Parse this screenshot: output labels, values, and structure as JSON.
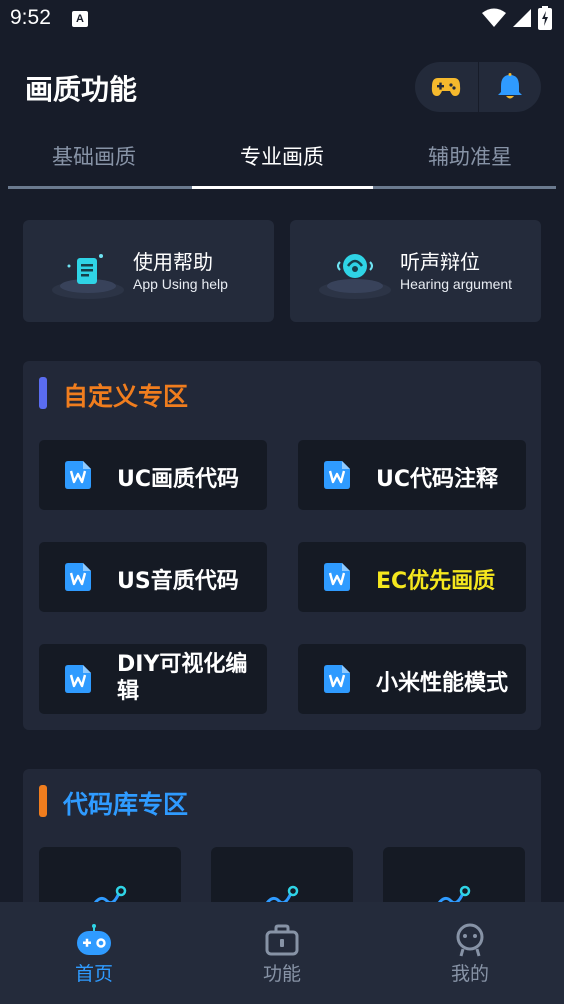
{
  "status": {
    "time": "9:52",
    "a_badge": "A"
  },
  "header": {
    "title": "画质功能",
    "actions": [
      {
        "icon": "gamepad-icon",
        "color": "#f5b92d"
      },
      {
        "icon": "bell-icon",
        "color": "#2f9bff"
      }
    ]
  },
  "tabs": [
    {
      "label": "基础画质",
      "active": false
    },
    {
      "label": "专业画质",
      "active": true
    },
    {
      "label": "辅助准星",
      "active": false
    }
  ],
  "help_cards": [
    {
      "title": "使用帮助",
      "subtitle": "App Using help",
      "icon": "help-document-icon"
    },
    {
      "title": "听声辩位",
      "subtitle": "Hearing argument",
      "icon": "hearing-icon"
    }
  ],
  "custom_section": {
    "title": "自定义专区",
    "accent_color": "#5a6cf0",
    "title_color": "#f07d1e",
    "items": [
      {
        "label": "UC画质代码",
        "color": "#ffffff"
      },
      {
        "label": "UC代码注释",
        "color": "#ffffff"
      },
      {
        "label": "US音质代码",
        "color": "#ffffff"
      },
      {
        "label": "EC优先画质",
        "color": "#f5e71e"
      },
      {
        "label": "DIY可视化编辑",
        "color": "#ffffff"
      },
      {
        "label": "小米性能模式",
        "color": "#ffffff"
      }
    ]
  },
  "library_section": {
    "title": "代码库专区",
    "accent_color": "#f07d1e",
    "title_color": "#2f9bff",
    "card_count": 3
  },
  "bottom_nav": [
    {
      "label": "首页",
      "icon": "home-controller-icon",
      "active": true
    },
    {
      "label": "功能",
      "icon": "toolbox-icon",
      "active": false
    },
    {
      "label": "我的",
      "icon": "profile-icon",
      "active": false
    }
  ],
  "colors": {
    "background": "#171c29",
    "card": "#242b3b",
    "button": "#151a24",
    "active_blue": "#2f9bff",
    "inactive": "#8793a6"
  }
}
